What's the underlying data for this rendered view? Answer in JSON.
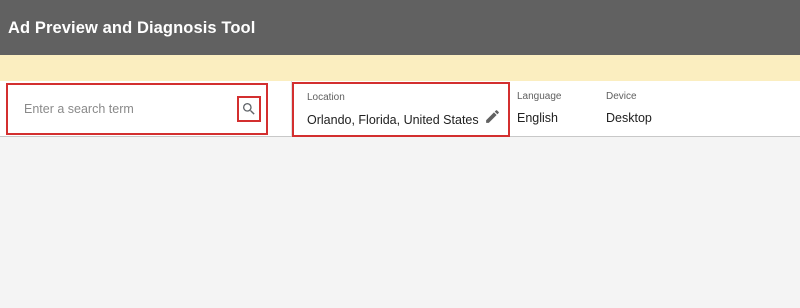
{
  "header": {
    "title": "Ad Preview and Diagnosis Tool"
  },
  "search": {
    "placeholder": "Enter a search term",
    "icon": "search-icon"
  },
  "settings": {
    "location": {
      "label": "Location",
      "value": "Orlando, Florida, United States",
      "edit_icon": "pencil-icon"
    },
    "language": {
      "label": "Language",
      "value": "English"
    },
    "device": {
      "label": "Device",
      "value": "Desktop"
    }
  },
  "colors": {
    "header_bg": "#616161",
    "notice_bg": "#fbeec0",
    "highlight": "#d32f2f",
    "page_bg": "#f4f4f4"
  }
}
